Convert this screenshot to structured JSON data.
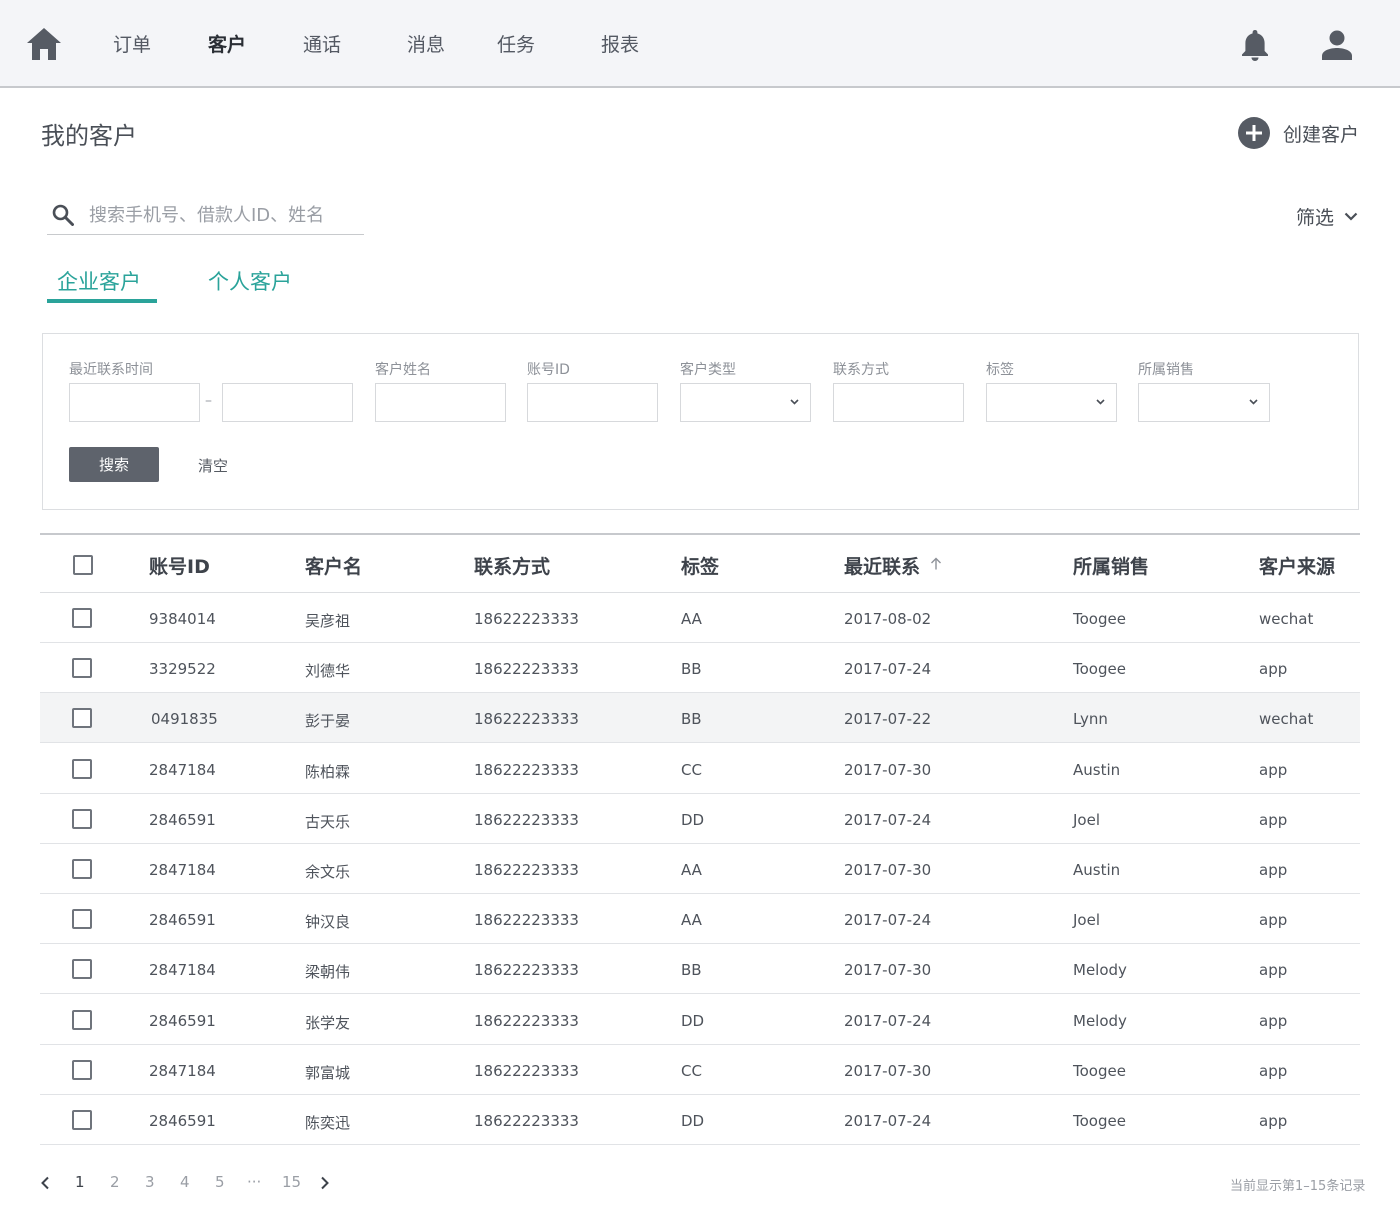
{
  "nav": {
    "items": [
      {
        "label": "订单",
        "active": false
      },
      {
        "label": "客户",
        "active": true
      },
      {
        "label": "通话",
        "active": false
      },
      {
        "label": "消息",
        "active": false
      },
      {
        "label": "任务",
        "active": false
      },
      {
        "label": "报表",
        "active": false
      }
    ],
    "icons": {
      "home": "home-icon",
      "bell": "bell-icon",
      "user": "user-icon"
    }
  },
  "page": {
    "title": "我的客户",
    "create_label": "创建客户"
  },
  "search": {
    "placeholder": "搜索手机号、借款人ID、姓名",
    "value": ""
  },
  "filter_toggle": {
    "label": "筛选"
  },
  "tabs": [
    {
      "label": "企业客户",
      "active": true
    },
    {
      "label": "个人客户",
      "active": false
    }
  ],
  "filters": {
    "recent_contact_label": "最近联系时间",
    "range_separator": "–",
    "customer_name_label": "客户姓名",
    "account_id_label": "账号ID",
    "customer_type_label": "客户类型",
    "contact_label": "联系方式",
    "tag_label": "标签",
    "sales_label": "所属销售",
    "search_button": "搜索",
    "clear_button": "清空"
  },
  "table": {
    "columns": [
      "账号ID",
      "客户名",
      "联系方式",
      "标签",
      "最近联系",
      "所属销售",
      "客户来源"
    ],
    "sorted_column": "最近联系",
    "sort_direction": "ascending",
    "rows": [
      {
        "id": "9384014",
        "name": "吴彦祖",
        "phone": "18622223333",
        "tag": "AA",
        "date": "2017-08-02",
        "sales": "Toogee",
        "source": "wechat"
      },
      {
        "id": "3329522",
        "name": "刘德华",
        "phone": "18622223333",
        "tag": "BB",
        "date": "2017-07-24",
        "sales": "Toogee",
        "source": "app"
      },
      {
        "id": "0491835",
        "name": "彭于晏",
        "phone": "18622223333",
        "tag": "BB",
        "date": "2017-07-22",
        "sales": "Lynn",
        "source": "wechat",
        "highlighted": true
      },
      {
        "id": "2847184",
        "name": "陈柏霖",
        "phone": "18622223333",
        "tag": "CC",
        "date": "2017-07-30",
        "sales": "Austin",
        "source": "app"
      },
      {
        "id": "2846591",
        "name": "古天乐",
        "phone": "18622223333",
        "tag": "DD",
        "date": "2017-07-24",
        "sales": "Joel",
        "source": "app"
      },
      {
        "id": "2847184",
        "name": "余文乐",
        "phone": "18622223333",
        "tag": "AA",
        "date": "2017-07-30",
        "sales": "Austin",
        "source": "app"
      },
      {
        "id": "2846591",
        "name": "钟汉良",
        "phone": "18622223333",
        "tag": "AA",
        "date": "2017-07-24",
        "sales": "Joel",
        "source": "app"
      },
      {
        "id": "2847184",
        "name": "梁朝伟",
        "phone": "18622223333",
        "tag": "BB",
        "date": "2017-07-30",
        "sales": "Melody",
        "source": "app"
      },
      {
        "id": "2846591",
        "name": "张学友",
        "phone": "18622223333",
        "tag": "DD",
        "date": "2017-07-24",
        "sales": "Melody",
        "source": "app"
      },
      {
        "id": "2847184",
        "name": "郭富城",
        "phone": "18622223333",
        "tag": "CC",
        "date": "2017-07-30",
        "sales": "Toogee",
        "source": "app"
      },
      {
        "id": "2846591",
        "name": "陈奕迅",
        "phone": "18622223333",
        "tag": "DD",
        "date": "2017-07-24",
        "sales": "Toogee",
        "source": "app"
      }
    ]
  },
  "pagination": {
    "pages": [
      "1",
      "2",
      "3",
      "4",
      "5",
      "···",
      "15"
    ],
    "current": "1",
    "record_info": "当前显示第1–15条记录"
  },
  "colors": {
    "accent": "#2aa39a",
    "nav_bg": "#f4f5f8",
    "button_dark": "#5e636c",
    "icon_dark": "#565b64"
  }
}
